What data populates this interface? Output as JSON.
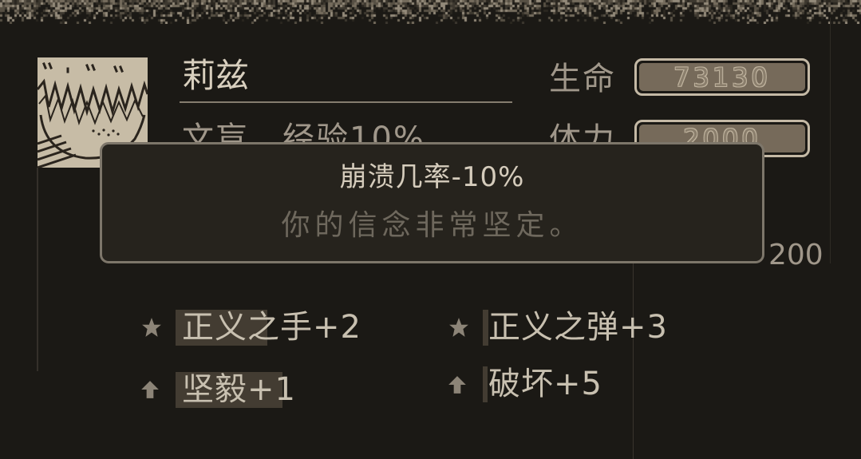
{
  "character": {
    "name": "莉兹"
  },
  "stats": [
    {
      "label": "生命",
      "value": "73130"
    },
    {
      "label": "体力",
      "value": "2000"
    }
  ],
  "traits": {
    "row1": "文盲　经验10%",
    "row3_tail": "200"
  },
  "tooltip": {
    "title": "崩溃几率-10%",
    "description": "你的信念非常坚定。"
  },
  "perks": [
    {
      "label": "正义之手+2",
      "icon": "star-icon",
      "progress": 0.82
    },
    {
      "label": "正义之弹+3",
      "icon": "star-icon",
      "progress": 0.05
    },
    {
      "label": "坚毅+1",
      "icon": "up-arrow-icon",
      "progress": 0.96
    },
    {
      "label": "破坏+5",
      "icon": "up-arrow-icon",
      "progress": 0.04
    }
  ],
  "colors": {
    "background": "#1b1915",
    "text": "#c8c0b0",
    "muted": "#a0978a",
    "bar_fill": "#766a5a",
    "bar_border": "#c4b9a5",
    "tooltip_border": "#7d766a",
    "progress_fill": "#433c32"
  }
}
